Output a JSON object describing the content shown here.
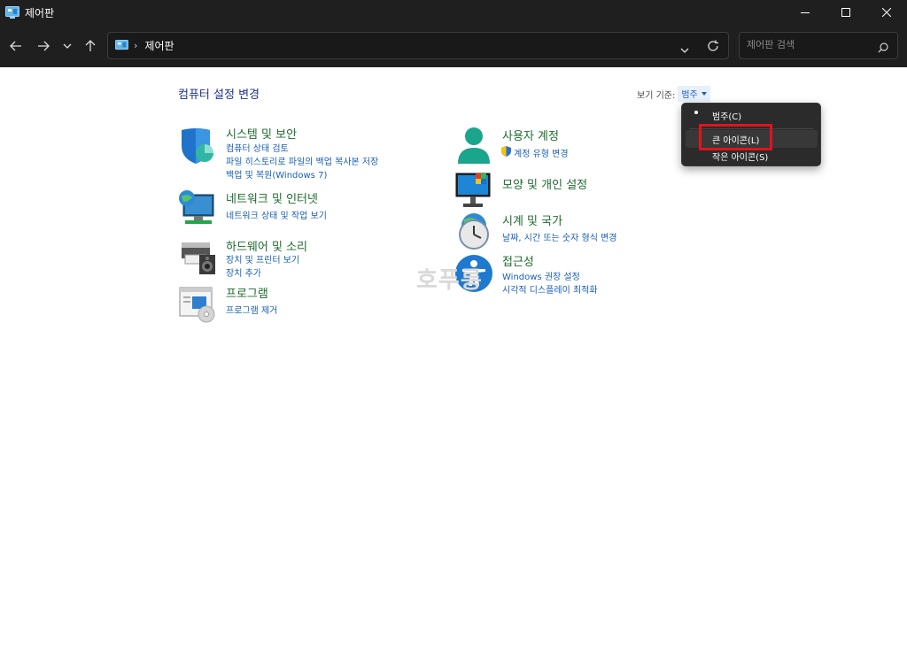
{
  "window": {
    "title": "제어판"
  },
  "address": {
    "location": "제어판",
    "separator": "›"
  },
  "search": {
    "placeholder": "제어판 검색"
  },
  "main": {
    "title": "컴퓨터 설정 변경",
    "view_by_label": "보기 기준:",
    "view_by_value": "범주"
  },
  "categories": [
    {
      "title": "시스템 및 보안",
      "links": [
        "컴퓨터 상태 검토",
        "파일 히스토리로 파일의 백업 복사본 저장",
        "백업 및 복원(Windows 7)"
      ],
      "icon": "shield-icon"
    },
    {
      "title": "네트워크 및 인터넷",
      "links": [
        "네트워크 상태 및 작업 보기"
      ],
      "icon": "network-globe-icon"
    },
    {
      "title": "하드웨어 및 소리",
      "links": [
        "장치 및 프린터 보기",
        "장치 추가"
      ],
      "icon": "printer-speaker-icon"
    },
    {
      "title": "프로그램",
      "links": [
        "프로그램 제거"
      ],
      "icon": "programs-icon"
    },
    {
      "title": "사용자 계정",
      "links": [
        "계정 유형 변경"
      ],
      "icon": "user-icon"
    },
    {
      "title": "모양 및 개인 설정",
      "links": [],
      "icon": "monitor-icon"
    },
    {
      "title": "시계 및 국가",
      "links": [
        "날짜, 시간 또는 숫자 형식 변경"
      ],
      "icon": "clock-globe-icon"
    },
    {
      "title": "접근성",
      "links": [
        "Windows 권장 설정",
        "시각적 디스플레이 최적화"
      ],
      "icon": "accessibility-icon"
    }
  ],
  "watermark": "호푸릉",
  "menu": {
    "items": [
      "범주(C)",
      "큰 아이콘(L)",
      "작은 아이콘(S)"
    ],
    "selected": "범주(C)"
  },
  "colors": {
    "titlebar_bg": "#1f1f1f",
    "category_title": "#1f6b2f",
    "link": "#1a5fb4",
    "highlight_box": "#e0141e"
  }
}
